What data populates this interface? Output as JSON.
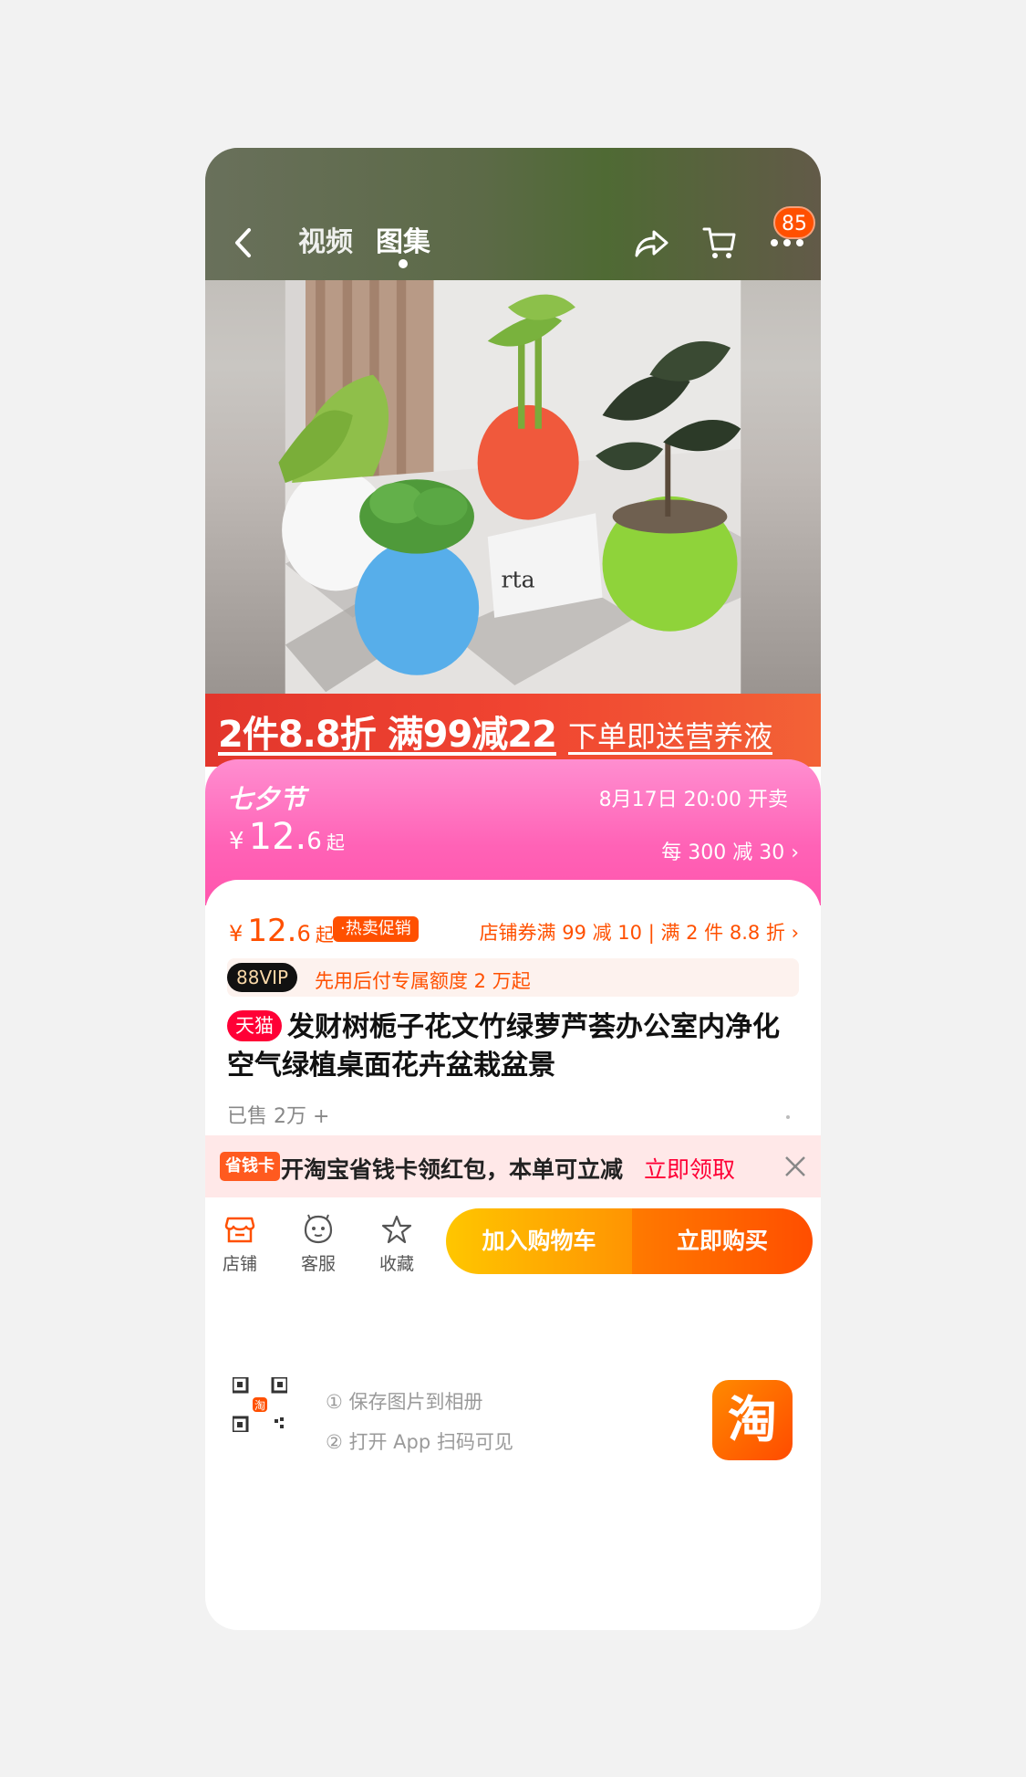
{
  "nav": {
    "tab_video": "视频",
    "tab_gallery": "图集",
    "badge_count": "85",
    "icons": [
      "back-icon",
      "share-icon",
      "cart-icon",
      "more-icon"
    ]
  },
  "promo": {
    "main": "2件8.8折 满99减22",
    "sub": "下单即送营养液"
  },
  "festival": {
    "name": "七夕节",
    "start_time": "8月17日 20:00 开卖",
    "currency": "¥",
    "price_int": "12.",
    "price_dec": "6",
    "price_suffix": "起",
    "discount": "每 300 减 30 ›"
  },
  "price": {
    "currency": "¥",
    "price_int": "12.",
    "price_dec": "6",
    "price_suffix": "起",
    "hot_tag": "·热卖促销",
    "coupon": "店铺券满 99 减 10 | 满 2 件 8.8 折 ›"
  },
  "vip": {
    "badge": "88VIP",
    "text": "先用后付专属额度 2 万起"
  },
  "product": {
    "tag": "天猫",
    "title": "发财树栀子花文竹绿萝芦荟办公室内净化空气绿植桌面花卉盆栽盆景",
    "sold": "已售 2万 +"
  },
  "redpacket": {
    "badge": "省钱卡",
    "text": "开淘宝省钱卡领红包，本单可立减",
    "link": "立即领取"
  },
  "actions": {
    "shop": "店铺",
    "service": "客服",
    "favorite": "收藏",
    "add_cart": "加入购物车",
    "buy_now": "立即购买"
  },
  "footer": {
    "step1": "① 保存图片到相册",
    "step2": "② 打开 App 扫码可见",
    "logo": "淘"
  },
  "colors": {
    "accent": "#ff5000",
    "tmall": "#ff0036",
    "festival_pink": "#ff62b6"
  }
}
